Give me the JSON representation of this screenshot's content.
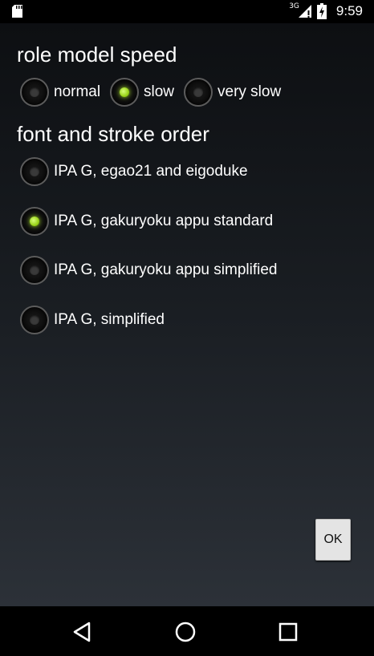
{
  "status_bar": {
    "network_type": "3G",
    "time": "9:59",
    "icons": [
      "sd-card-icon",
      "signal-icon",
      "battery-charging-icon"
    ]
  },
  "speed_section": {
    "title": "role model speed",
    "options": [
      {
        "label": "normal",
        "checked": false
      },
      {
        "label": "slow",
        "checked": true
      },
      {
        "label": "very slow",
        "checked": false
      }
    ]
  },
  "font_section": {
    "title": "font and stroke order",
    "options": [
      {
        "label": "IPA G, egao21 and eigoduke",
        "checked": false
      },
      {
        "label": "IPA G, gakuryoku appu standard",
        "checked": true
      },
      {
        "label": "IPA G, gakuryoku appu simplified",
        "checked": false
      },
      {
        "label": "IPA G, simplified",
        "checked": false
      }
    ]
  },
  "ok_button": {
    "label": "OK"
  },
  "nav_bar": {
    "icons": [
      "back-icon",
      "home-icon",
      "recents-icon"
    ]
  },
  "colors": {
    "accent_checked": "#9ad319",
    "background_top": "#0d0f12",
    "background_bottom": "#2c3138"
  }
}
